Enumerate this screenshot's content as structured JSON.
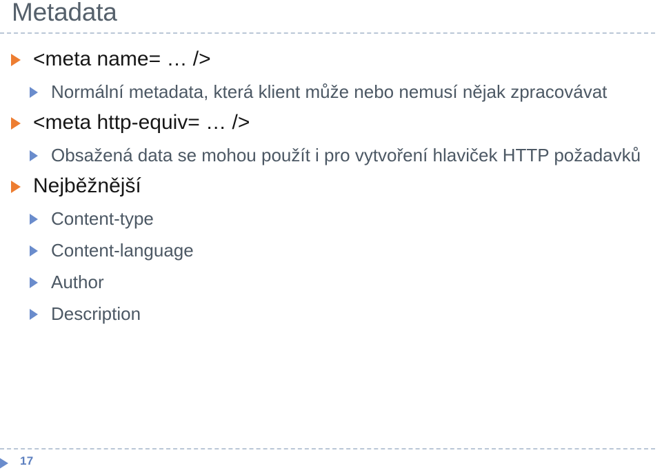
{
  "slide": {
    "title": "Metadata",
    "page_number": "17",
    "colors": {
      "title": "#55606b",
      "level1_text": "#161616",
      "level2_text": "#4c5864",
      "level1_bullet": "#ed7d31",
      "level2_bullet": "#6a8ccc",
      "rule": "#b9c6d6",
      "page_number": "#5c7fbf",
      "background": "#ffffff"
    },
    "bullets": [
      {
        "level": 1,
        "text": "<meta name= … />"
      },
      {
        "level": 2,
        "text": "Normální metadata, která klient může nebo nemusí nějak zpracovávat"
      },
      {
        "level": 1,
        "text": "<meta http-equiv= … />"
      },
      {
        "level": 2,
        "text": "Obsažená data se mohou použít i pro vytvoření hlaviček HTTP požadavků"
      },
      {
        "level": 1,
        "text": "Nejběžnější"
      },
      {
        "level": 2,
        "text": "Content-type"
      },
      {
        "level": 2,
        "text": "Content-language"
      },
      {
        "level": 2,
        "text": "Author"
      },
      {
        "level": 2,
        "text": "Description"
      }
    ]
  }
}
